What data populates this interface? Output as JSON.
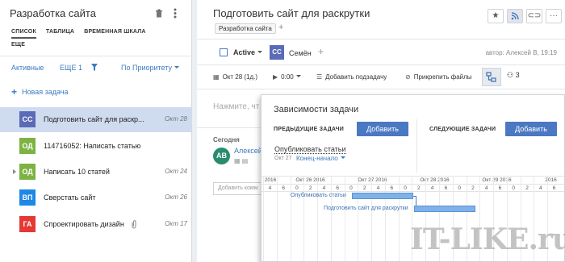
{
  "left": {
    "project_title": "Разработка сайта",
    "view_tabs": [
      "СПИСОК",
      "ТАБЛИЦА",
      "ВРЕМЕННАЯ ШКАЛА",
      "ЕЩЕ"
    ],
    "filter": {
      "active": "Активные",
      "more": "ЕЩЕ 1",
      "sort": "По Приоритету"
    },
    "new_task": "Новая задача",
    "tasks": [
      {
        "initials": "СС",
        "color": "#5b6bb7",
        "name": "Подготовить сайт для раскр...",
        "date": "Окт 28",
        "selected": true
      },
      {
        "initials": "ОД",
        "color": "#7cb342",
        "name": "114716052: Написать статью",
        "date": ""
      },
      {
        "initials": "ОД",
        "color": "#7cb342",
        "name": "Написать 10 статей",
        "date": "Окт 24",
        "expandable": true
      },
      {
        "initials": "ВП",
        "color": "#1e88e5",
        "name": "Сверстать сайт",
        "date": "Окт 26"
      },
      {
        "initials": "ГА",
        "color": "#e53935",
        "name": "Спроектировать дизайн",
        "date": "Окт 17",
        "attachment": true
      }
    ]
  },
  "task": {
    "title": "Подготовить сайт для раскрутки",
    "breadcrumb": "Разработка сайта",
    "status": "Active",
    "assignee_initials": "СС",
    "assignee_name": "Семён",
    "author": "автор: Алексей В, 19:19",
    "actions": {
      "date": "Окт 28 (1д.)",
      "timer": "0:00",
      "add_subtask": "Добавить подзадачу",
      "attach": "Прикрепить файлы",
      "subtasks_count": "3"
    },
    "comment_placeholder": "Нажмите, чт",
    "today": "Сегодня",
    "commenter_initials": "АВ",
    "commenter_name": "Алексей",
    "add_comment_placeholder": "Добавить комм"
  },
  "popup": {
    "title": "Зависимости задачи",
    "predecessors_label": "ПРЕДЫДУЩИЕ ЗАДАЧИ",
    "successors_label": "СЛЕДУЮЩИЕ ЗАДАЧИ",
    "add_label": "Добавить",
    "dependency": {
      "name": "Опубликовать статьи",
      "date": "Окт 27",
      "type": "Конец-начало"
    },
    "gantt": {
      "days": [
        "2016",
        "Окт 26 2016",
        "Окт 27 2016",
        "Окт 28 2016",
        "Окт 29 2016",
        "2016"
      ],
      "hours": [
        "4",
        "6",
        "0",
        "2",
        "4",
        "6",
        "0",
        "2",
        "4",
        "6",
        "0",
        "2",
        "4",
        "6",
        "0",
        "2",
        "4",
        "6",
        "0",
        "2",
        "4",
        "6"
      ],
      "bars": [
        {
          "label": "Опубликовать статьи"
        },
        {
          "label": "Подготовить сайт для раскрутки"
        }
      ]
    }
  },
  "watermark": "IT-LIKE.ru"
}
